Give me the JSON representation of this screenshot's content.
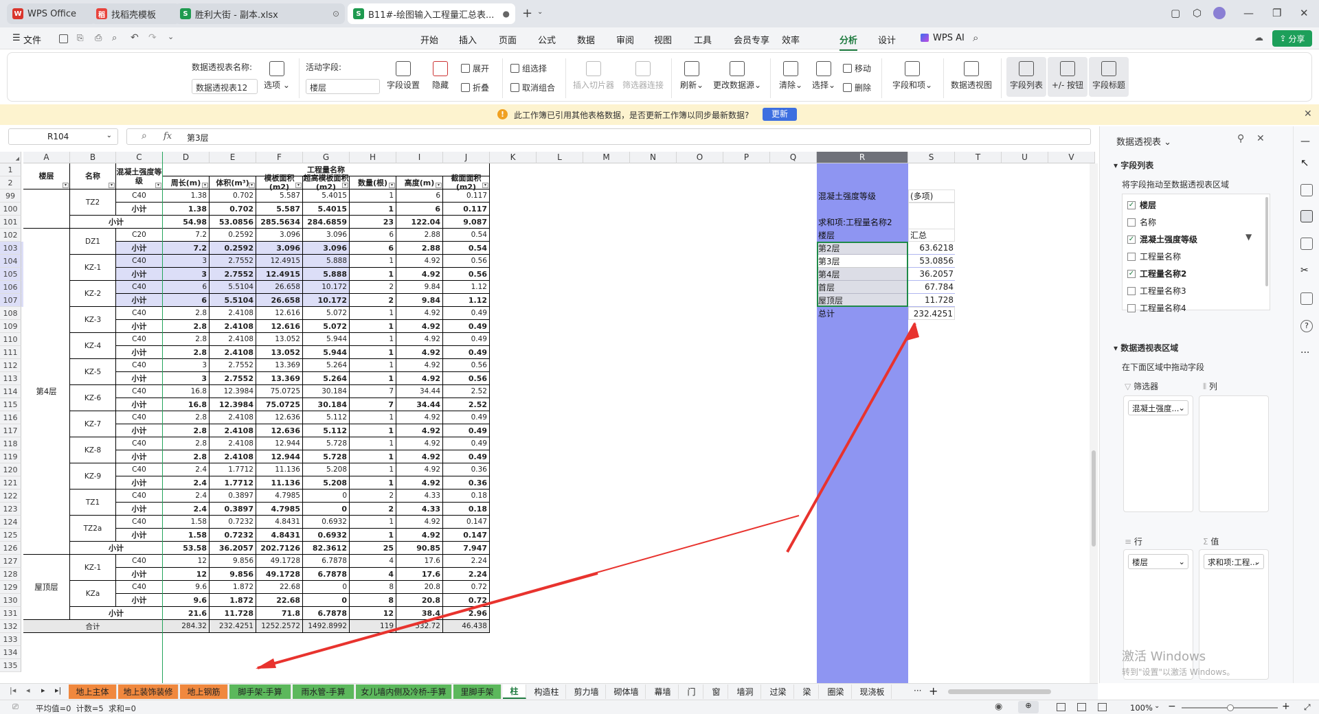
{
  "tabs": [
    {
      "label": "WPS Office",
      "icon": "W",
      "color": "#d9352c"
    },
    {
      "label": "找稻壳模板",
      "icon": "稻",
      "color": "#e8433c"
    },
    {
      "label": "胜利大街 - 副本.xlsx",
      "icon": "S",
      "color": "#1e9a4f"
    },
    {
      "label": "B11#-绘图输入工程量汇总表...",
      "icon": "S",
      "color": "#1e9a4f"
    }
  ],
  "menu": {
    "file": "文件",
    "items": [
      "开始",
      "插入",
      "页面",
      "公式",
      "数据",
      "审阅",
      "视图",
      "工具",
      "会员专享",
      "效率",
      "分析",
      "设计"
    ],
    "active": "分析",
    "wpsai": "WPS AI",
    "share": "分享"
  },
  "ribbon": {
    "pivot_name_label": "数据透视表名称:",
    "pivot_name": "数据透视表12",
    "options": "选项",
    "active_field_label": "活动字段:",
    "active_field": "楼层",
    "field_settings": "字段设置",
    "hide": "隐藏",
    "expand": "展开",
    "collapse": "折叠",
    "group_sel": "组选择",
    "ungroup": "取消组合",
    "insert_slicer": "插入切片器",
    "filter_conn": "筛选器连接",
    "refresh": "刷新",
    "change_source": "更改数据源",
    "clear": "清除",
    "select": "选择",
    "move": "移动",
    "delete": "删除",
    "fields_items": "字段和项",
    "pivot_chart": "数据透视图",
    "field_list": "字段列表",
    "pm_buttons": "+/- 按钮",
    "field_header": "字段标题"
  },
  "notice": {
    "text": "此工作簿已引用其他表格数据，是否更新工作簿以同步最新数据?",
    "button": "更新"
  },
  "formula": {
    "namebox": "R104",
    "fx": "fx",
    "value": "第3层"
  },
  "columns": [
    "A",
    "B",
    "C",
    "D",
    "E",
    "F",
    "G",
    "H",
    "I",
    "J",
    "K",
    "L",
    "M",
    "N",
    "O",
    "P",
    "Q",
    "R",
    "S",
    "T",
    "U",
    "V"
  ],
  "headers": {
    "floor": "楼层",
    "name": "名称",
    "grade": "混凝土强度等级",
    "quantity": "工程量名称",
    "perimeter": "周长(m)",
    "volume": "体积(m³)",
    "formwork": "模板面积(m2)",
    "over_formwork": "超高模板面积(m2)",
    "count": "数量(根)",
    "height": "高度(m)",
    "section": "截面面积(m2)"
  },
  "rows": [
    {
      "r": 99,
      "grade": "C40",
      "v": [
        "1.38",
        "0.702",
        "5.587",
        "5.4015",
        "1",
        "6",
        "0.117"
      ]
    },
    {
      "r": 100,
      "grade": "小计",
      "v": [
        "1.38",
        "0.702",
        "5.587",
        "5.4015",
        "1",
        "6",
        "0.117"
      ]
    },
    {
      "r": 101,
      "name": "小计",
      "v": [
        "54.98",
        "53.0856",
        "285.5634",
        "284.6859",
        "23",
        "122.04",
        "9.087"
      ]
    },
    {
      "r": 102,
      "grade": "C20",
      "v": [
        "7.2",
        "0.2592",
        "3.096",
        "3.096",
        "6",
        "2.88",
        "0.54"
      ]
    },
    {
      "r": 103,
      "grade": "小计",
      "v": [
        "7.2",
        "0.2592",
        "3.096",
        "3.096",
        "6",
        "2.88",
        "0.54"
      ]
    },
    {
      "r": 104,
      "grade": "C40",
      "v": [
        "3",
        "2.7552",
        "12.4915",
        "5.888",
        "1",
        "4.92",
        "0.56"
      ]
    },
    {
      "r": 105,
      "grade": "小计",
      "v": [
        "3",
        "2.7552",
        "12.4915",
        "5.888",
        "1",
        "4.92",
        "0.56"
      ]
    },
    {
      "r": 106,
      "grade": "C40",
      "v": [
        "6",
        "5.5104",
        "26.658",
        "10.172",
        "2",
        "9.84",
        "1.12"
      ]
    },
    {
      "r": 107,
      "grade": "小计",
      "v": [
        "6",
        "5.5104",
        "26.658",
        "10.172",
        "2",
        "9.84",
        "1.12"
      ]
    },
    {
      "r": 108,
      "grade": "C40",
      "v": [
        "2.8",
        "2.4108",
        "12.616",
        "5.072",
        "1",
        "4.92",
        "0.49"
      ]
    },
    {
      "r": 109,
      "grade": "小计",
      "v": [
        "2.8",
        "2.4108",
        "12.616",
        "5.072",
        "1",
        "4.92",
        "0.49"
      ]
    },
    {
      "r": 110,
      "grade": "C40",
      "v": [
        "2.8",
        "2.4108",
        "13.052",
        "5.944",
        "1",
        "4.92",
        "0.49"
      ]
    },
    {
      "r": 111,
      "grade": "小计",
      "v": [
        "2.8",
        "2.4108",
        "13.052",
        "5.944",
        "1",
        "4.92",
        "0.49"
      ]
    },
    {
      "r": 112,
      "grade": "C40",
      "v": [
        "3",
        "2.7552",
        "13.369",
        "5.264",
        "1",
        "4.92",
        "0.56"
      ]
    },
    {
      "r": 113,
      "grade": "小计",
      "v": [
        "3",
        "2.7552",
        "13.369",
        "5.264",
        "1",
        "4.92",
        "0.56"
      ]
    },
    {
      "r": 114,
      "grade": "C40",
      "v": [
        "16.8",
        "12.3984",
        "75.0725",
        "30.184",
        "7",
        "34.44",
        "2.52"
      ]
    },
    {
      "r": 115,
      "grade": "小计",
      "v": [
        "16.8",
        "12.3984",
        "75.0725",
        "30.184",
        "7",
        "34.44",
        "2.52"
      ]
    },
    {
      "r": 116,
      "grade": "C40",
      "v": [
        "2.8",
        "2.4108",
        "12.636",
        "5.112",
        "1",
        "4.92",
        "0.49"
      ]
    },
    {
      "r": 117,
      "grade": "小计",
      "v": [
        "2.8",
        "2.4108",
        "12.636",
        "5.112",
        "1",
        "4.92",
        "0.49"
      ]
    },
    {
      "r": 118,
      "grade": "C40",
      "v": [
        "2.8",
        "2.4108",
        "12.944",
        "5.728",
        "1",
        "4.92",
        "0.49"
      ]
    },
    {
      "r": 119,
      "grade": "小计",
      "v": [
        "2.8",
        "2.4108",
        "12.944",
        "5.728",
        "1",
        "4.92",
        "0.49"
      ]
    },
    {
      "r": 120,
      "grade": "C40",
      "v": [
        "2.4",
        "1.7712",
        "11.136",
        "5.208",
        "1",
        "4.92",
        "0.36"
      ]
    },
    {
      "r": 121,
      "grade": "小计",
      "v": [
        "2.4",
        "1.7712",
        "11.136",
        "5.208",
        "1",
        "4.92",
        "0.36"
      ]
    },
    {
      "r": 122,
      "grade": "C40",
      "v": [
        "2.4",
        "0.3897",
        "4.7985",
        "0",
        "2",
        "4.33",
        "0.18"
      ]
    },
    {
      "r": 123,
      "grade": "小计",
      "v": [
        "2.4",
        "0.3897",
        "4.7985",
        "0",
        "2",
        "4.33",
        "0.18"
      ]
    },
    {
      "r": 124,
      "grade": "C40",
      "v": [
        "1.58",
        "0.7232",
        "4.8431",
        "0.6932",
        "1",
        "4.92",
        "0.147"
      ]
    },
    {
      "r": 125,
      "grade": "小计",
      "v": [
        "1.58",
        "0.7232",
        "4.8431",
        "0.6932",
        "1",
        "4.92",
        "0.147"
      ]
    },
    {
      "r": 126,
      "name": "小计",
      "v": [
        "53.58",
        "36.2057",
        "202.7126",
        "82.3612",
        "25",
        "90.85",
        "7.947"
      ]
    },
    {
      "r": 127,
      "grade": "C40",
      "v": [
        "12",
        "9.856",
        "49.1728",
        "6.7878",
        "4",
        "17.6",
        "2.24"
      ]
    },
    {
      "r": 128,
      "grade": "小计",
      "v": [
        "12",
        "9.856",
        "49.1728",
        "6.7878",
        "4",
        "17.6",
        "2.24"
      ]
    },
    {
      "r": 129,
      "grade": "C40",
      "v": [
        "9.6",
        "1.872",
        "22.68",
        "0",
        "8",
        "20.8",
        "0.72"
      ]
    },
    {
      "r": 130,
      "grade": "小计",
      "v": [
        "9.6",
        "1.872",
        "22.68",
        "0",
        "8",
        "20.8",
        "0.72"
      ]
    },
    {
      "r": 131,
      "name": "小计",
      "v": [
        "21.6",
        "11.728",
        "71.8",
        "6.7878",
        "12",
        "38.4",
        "2.96"
      ]
    },
    {
      "r": 132,
      "floor": "合计",
      "v": [
        "284.32",
        "232.4251",
        "1252.2572",
        "1492.8992",
        "119",
        "532.72",
        "46.438"
      ]
    }
  ],
  "merged": {
    "names": [
      {
        "label": "TZ2",
        "rows": [
          99,
          100
        ]
      },
      {
        "label": "DZ1",
        "rows": [
          102,
          103
        ]
      },
      {
        "label": "KZ-1",
        "rows": [
          104,
          105
        ]
      },
      {
        "label": "KZ-2",
        "rows": [
          106,
          107
        ]
      },
      {
        "label": "KZ-3",
        "rows": [
          108,
          109
        ]
      },
      {
        "label": "KZ-4",
        "rows": [
          110,
          111
        ]
      },
      {
        "label": "KZ-5",
        "rows": [
          112,
          113
        ]
      },
      {
        "label": "KZ-6",
        "rows": [
          114,
          115
        ]
      },
      {
        "label": "KZ-7",
        "rows": [
          116,
          117
        ]
      },
      {
        "label": "KZ-8",
        "rows": [
          118,
          119
        ]
      },
      {
        "label": "KZ-9",
        "rows": [
          120,
          121
        ]
      },
      {
        "label": "TZ1",
        "rows": [
          122,
          123
        ]
      },
      {
        "label": "TZ2a",
        "rows": [
          124,
          125
        ]
      },
      {
        "label": "KZ-1",
        "rows": [
          127,
          128
        ]
      },
      {
        "label": "KZa",
        "rows": [
          129,
          130
        ]
      }
    ],
    "floors": [
      {
        "label": "第4层",
        "rows": [
          102,
          126
        ]
      },
      {
        "label": "屋顶层",
        "rows": [
          127,
          131
        ]
      }
    ]
  },
  "pivot": {
    "filter_label": "混凝土强度等级",
    "filter_value": "(多项)",
    "sum_label": "求和项:工程量名称2",
    "row_header": "楼层",
    "value_header": "汇总",
    "items": [
      {
        "label": "第2层",
        "value": "63.6218"
      },
      {
        "label": "第3层",
        "value": "53.0856"
      },
      {
        "label": "第4层",
        "value": "36.2057"
      },
      {
        "label": "首层",
        "value": "67.784"
      },
      {
        "label": "屋顶层",
        "value": "11.728"
      }
    ],
    "total_label": "总计",
    "total_value": "232.4251"
  },
  "sheets": [
    {
      "label": "地上主体",
      "color": "#f0883e"
    },
    {
      "label": "地上装饰装修",
      "color": "#f0883e"
    },
    {
      "label": "地上钢筋",
      "color": "#f0883e"
    },
    {
      "label": "脚手架-手算",
      "color": "#5cb85c"
    },
    {
      "label": "雨水管-手算",
      "color": "#5cb85c"
    },
    {
      "label": "女儿墙内侧及冷桥-手算",
      "color": "#5cb85c"
    },
    {
      "label": "里脚手架",
      "color": "#5cb85c"
    },
    {
      "label": "柱",
      "color": "active"
    },
    {
      "label": "构造柱",
      "color": ""
    },
    {
      "label": "剪力墙",
      "color": ""
    },
    {
      "label": "砌体墙",
      "color": ""
    },
    {
      "label": "幕墙",
      "color": ""
    },
    {
      "label": "门",
      "color": ""
    },
    {
      "label": "窗",
      "color": ""
    },
    {
      "label": "墙洞",
      "color": ""
    },
    {
      "label": "过梁",
      "color": ""
    },
    {
      "label": "梁",
      "color": ""
    },
    {
      "label": "圈梁",
      "color": ""
    },
    {
      "label": "现浇板",
      "color": ""
    }
  ],
  "status": {
    "text": "平均值=0  计数=5  求和=0",
    "zoom": "100%"
  },
  "panel": {
    "title": "数据透视表",
    "field_list": "字段列表",
    "drag_hint": "将字段拖动至数据透视表区域",
    "fields": [
      {
        "label": "楼层",
        "checked": true
      },
      {
        "label": "名称",
        "checked": false
      },
      {
        "label": "混凝土强度等级",
        "checked": true
      },
      {
        "label": "工程量名称",
        "checked": false
      },
      {
        "label": "工程量名称2",
        "checked": true
      },
      {
        "label": "工程量名称3",
        "checked": false
      },
      {
        "label": "工程量名称4",
        "checked": false
      }
    ],
    "area_title": "数据透视表区域",
    "area_hint": "在下面区域中拖动字段",
    "filter_zone": "筛选器",
    "col_zone": "列",
    "row_zone": "行",
    "val_zone": "值",
    "filter_chip": "混凝土强度...",
    "row_chip": "楼层",
    "val_chip": "求和项:工程..."
  },
  "watermark": {
    "line1": "激活 Windows",
    "line2": "转到\"设置\"以激活 Windows。"
  }
}
